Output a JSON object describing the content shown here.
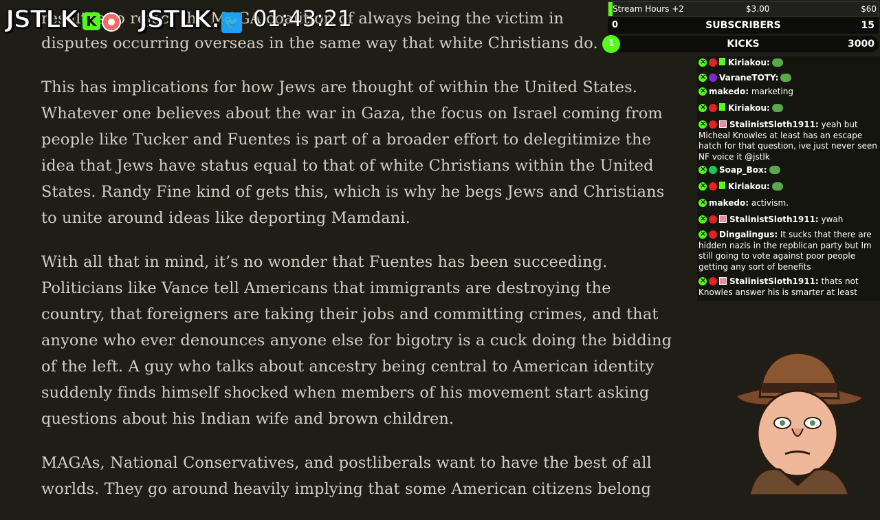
{
  "overlay": {
    "brand_primary": "JSTLK",
    "brand_secondary": "JSTLK.",
    "k_icon": "K",
    "timer": "01:43:21",
    "icons": [
      "kick-logo-icon",
      "record-icon",
      "twitter-icon"
    ]
  },
  "goals": {
    "hours": {
      "label": "Stream Hours +2",
      "current": "$3.00",
      "max": "$60",
      "progress": 0.015
    },
    "subscribers": {
      "label": "SUBSCRIBERS",
      "current": "0",
      "target": "15"
    },
    "kicks": {
      "label": "KICKS",
      "current": "1",
      "target": "3000"
    }
  },
  "article": {
    "p1": "Tucker's result is to reject the MAGA coalition of always being the victim in disputes occurring overseas in the same way that white Christians do.",
    "p1_visible": "disputes occurring overseas in the same way that white Christians do.",
    "p2": "This has implications for how Jews are thought of within the United States. Whatever one believes about the war in Gaza, the focus on Israel coming from people like Tucker and Fuentes is part of a broader effort to delegitimize the idea that Jews have status equal to that of white Christians within the United States. Randy Fine kind of gets this, which is why he begs Jews and Christians to unite around ideas like deporting Mamdani.",
    "p3": "With all that in mind, it’s no wonder that Fuentes has been succeeding. Politicians like Vance tell Americans that immigrants are destroying the country, that foreigners are taking their jobs and committing crimes, and that anyone who ever denounces anyone else for bigotry is a cuck doing the bidding of the left. A guy who talks about ancestry being central to American identity suddenly finds himself shocked when members of his movement start asking questions about his Indian wife and brown children.",
    "p4": "MAGAs, National Conservatives, and postliberals want to have the best of all worlds. They go around heavily implying that some American citizens belong"
  },
  "chat": [
    {
      "user": "Kiriakou:",
      "text": "",
      "badges": [
        "mod",
        "red",
        "sub"
      ],
      "emote": true
    },
    {
      "user": "VaraneTOTY:",
      "text": "",
      "badges": [
        "mod",
        "purple"
      ],
      "emote": true
    },
    {
      "user": "makedo:",
      "text": "marketing",
      "badges": [
        "mod"
      ]
    },
    {
      "user": "Kiriakou:",
      "text": "",
      "badges": [
        "mod",
        "red",
        "sub"
      ],
      "emote": true
    },
    {
      "user": "StalinistSloth1911:",
      "text": "yeah but Micheal Knowles at least has an escape hatch for that question, ive just never seen NF voice it @jstlk",
      "badges": [
        "mod",
        "red",
        "gift"
      ]
    },
    {
      "user": "Soap_Box:",
      "text": "",
      "badges": [
        "mod",
        "green"
      ],
      "emote": true
    },
    {
      "user": "Kiriakou:",
      "text": "",
      "badges": [
        "mod",
        "red",
        "sub"
      ],
      "emote": true
    },
    {
      "user": "makedo:",
      "text": "activism.",
      "badges": [
        "mod"
      ]
    },
    {
      "user": "StalinistSloth1911:",
      "text": "ywah",
      "badges": [
        "mod",
        "red",
        "gift"
      ]
    },
    {
      "user": "Dingalingus:",
      "text": "It sucks that there are hidden nazis in the repblican party but Im still going to vote against poor people getting any sort of benefits",
      "badges": [
        "mod",
        "red"
      ]
    },
    {
      "user": "StalinistSloth1911:",
      "text": "thats not Knowles answer his is smarter at least",
      "badges": [
        "mod",
        "red",
        "gift"
      ]
    }
  ],
  "colors": {
    "kick_green": "#53fc18",
    "background": "#1e1e16",
    "article_text": "#d2cfc2"
  }
}
